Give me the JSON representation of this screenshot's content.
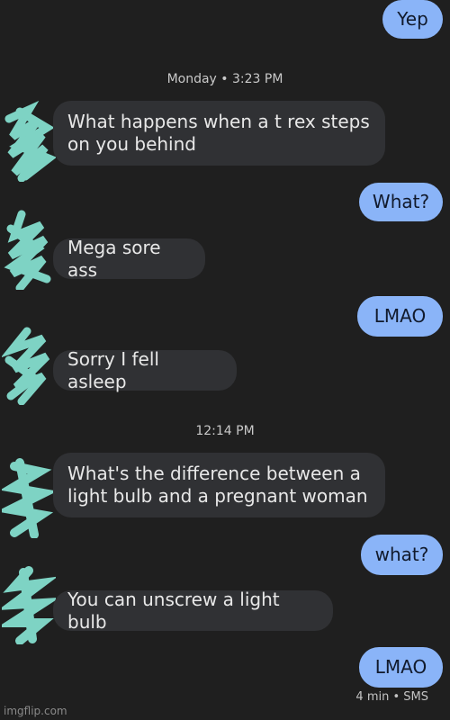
{
  "conversation": {
    "messages": [
      {
        "direction": "sent",
        "text": "Yep"
      },
      {
        "direction": "received",
        "text": "What happens when a  t rex steps\non you behind"
      },
      {
        "direction": "sent",
        "text": "What?"
      },
      {
        "direction": "received",
        "text": "Mega sore ass"
      },
      {
        "direction": "sent",
        "text": "LMAO"
      },
      {
        "direction": "received",
        "text": "Sorry I fell asleep"
      },
      {
        "direction": "received",
        "text": "What's the difference between a\nlight bulb and a pregnant woman"
      },
      {
        "direction": "sent",
        "text": "what?"
      },
      {
        "direction": "received",
        "text": "You can unscrew a light bulb"
      },
      {
        "direction": "sent",
        "text": "LMAO"
      }
    ],
    "timestamps": [
      "Monday • 3:23 PM",
      "12:14 PM"
    ],
    "last_status": "4 min • SMS"
  },
  "watermark": "imgflip.com",
  "colors": {
    "background": "#1f1f1f",
    "received_bubble": "#303134",
    "sent_bubble": "#8ab4f8",
    "avatar_scribble": "#7ed3c4"
  },
  "avatar_icon": "scribbled-avatar-icon"
}
